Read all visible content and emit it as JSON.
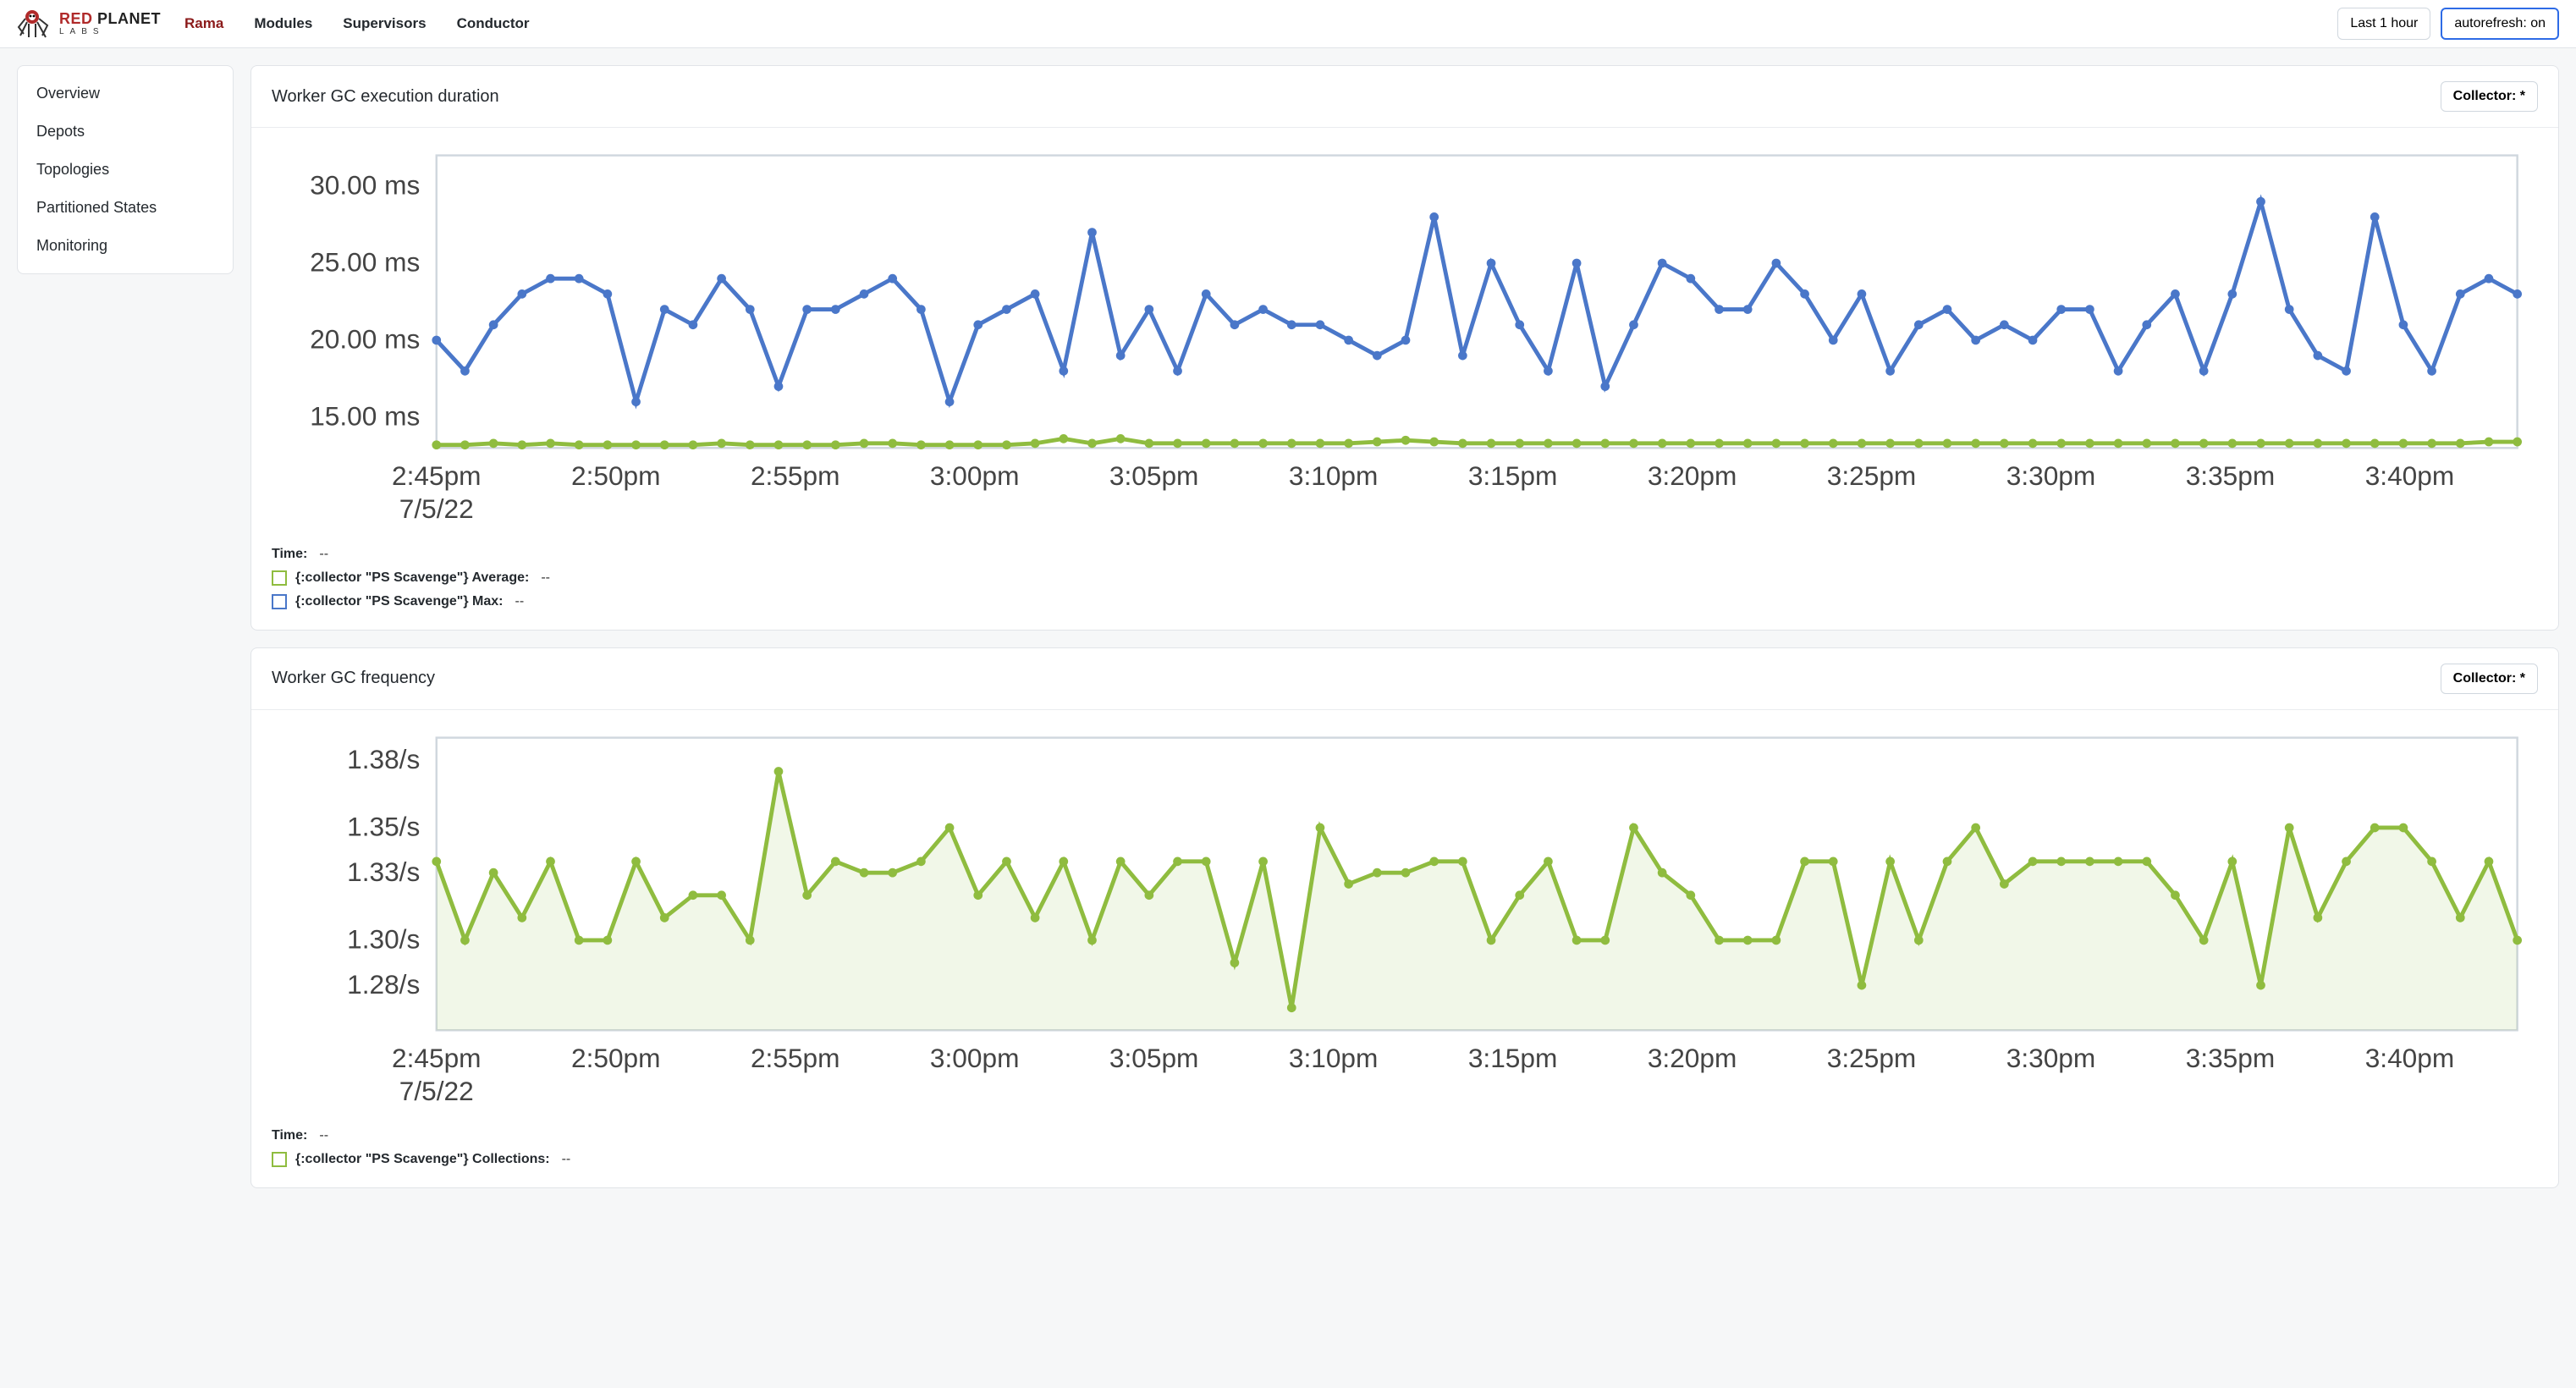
{
  "header": {
    "logo_line1_a": "RED",
    "logo_line1_b": "PLANET",
    "logo_line2": "LABS",
    "nav": [
      "Rama",
      "Modules",
      "Supervisors",
      "Conductor"
    ],
    "timerange_label": "Last 1 hour",
    "autorefresh_label": "autorefresh: on"
  },
  "sidebar": {
    "items": [
      "Overview",
      "Depots",
      "Topologies",
      "Partitioned States",
      "Monitoring"
    ]
  },
  "collector_label": "Collector: *",
  "panels": [
    {
      "title": "Worker GC execution duration",
      "legend": [
        {
          "kind": "time",
          "label": "Time:",
          "value": "--"
        },
        {
          "kind": "green",
          "label": "{:collector \"PS Scavenge\"} Average:",
          "value": "--"
        },
        {
          "kind": "blue",
          "label": "{:collector \"PS Scavenge\"} Max:",
          "value": "--"
        }
      ]
    },
    {
      "title": "Worker GC frequency",
      "legend": [
        {
          "kind": "time",
          "label": "Time:",
          "value": "--"
        },
        {
          "kind": "green",
          "label": "{:collector \"PS Scavenge\"} Collections:",
          "value": "--"
        }
      ]
    }
  ],
  "chart_data": [
    {
      "type": "line",
      "title": "Worker GC execution duration",
      "xlabel": "",
      "ylabel": "",
      "x_start_label": "2:45pm",
      "x_start_date": "7/5/22",
      "x_tick_labels": [
        "2:45pm",
        "2:50pm",
        "2:55pm",
        "3:00pm",
        "3:05pm",
        "3:10pm",
        "3:15pm",
        "3:20pm",
        "3:25pm",
        "3:30pm",
        "3:35pm",
        "3:40pm"
      ],
      "y_tick_labels": [
        "15.00 ms",
        "20.00 ms",
        "25.00 ms",
        "30.00 ms"
      ],
      "ylim": [
        13,
        32
      ],
      "series": [
        {
          "name": "{:collector \"PS Scavenge\"} Max",
          "color": "#4a77c9",
          "values": [
            20,
            18,
            21,
            23,
            24,
            24,
            23,
            16,
            22,
            21,
            24,
            22,
            17,
            22,
            22,
            23,
            24,
            22,
            16,
            21,
            22,
            23,
            18,
            27,
            19,
            22,
            18,
            23,
            21,
            22,
            21,
            21,
            20,
            19,
            20,
            28,
            19,
            25,
            21,
            18,
            25,
            17,
            21,
            25,
            24,
            22,
            22,
            25,
            23,
            20,
            23,
            18,
            21,
            22,
            20,
            21,
            20,
            22,
            22,
            18,
            21,
            23,
            18,
            23,
            29,
            22,
            19,
            18,
            28,
            21,
            18,
            23,
            24,
            23
          ]
        },
        {
          "name": "{:collector \"PS Scavenge\"} Average",
          "color": "#8fbc3f",
          "values": [
            13.2,
            13.2,
            13.3,
            13.2,
            13.3,
            13.2,
            13.2,
            13.2,
            13.2,
            13.2,
            13.3,
            13.2,
            13.2,
            13.2,
            13.2,
            13.3,
            13.3,
            13.2,
            13.2,
            13.2,
            13.2,
            13.3,
            13.6,
            13.3,
            13.6,
            13.3,
            13.3,
            13.3,
            13.3,
            13.3,
            13.3,
            13.3,
            13.3,
            13.4,
            13.5,
            13.4,
            13.3,
            13.3,
            13.3,
            13.3,
            13.3,
            13.3,
            13.3,
            13.3,
            13.3,
            13.3,
            13.3,
            13.3,
            13.3,
            13.3,
            13.3,
            13.3,
            13.3,
            13.3,
            13.3,
            13.3,
            13.3,
            13.3,
            13.3,
            13.3,
            13.3,
            13.3,
            13.3,
            13.3,
            13.3,
            13.3,
            13.3,
            13.3,
            13.3,
            13.3,
            13.3,
            13.3,
            13.4,
            13.4
          ]
        }
      ]
    },
    {
      "type": "area",
      "title": "Worker GC frequency",
      "xlabel": "",
      "ylabel": "",
      "x_start_label": "2:45pm",
      "x_start_date": "7/5/22",
      "x_tick_labels": [
        "2:45pm",
        "2:50pm",
        "2:55pm",
        "3:00pm",
        "3:05pm",
        "3:10pm",
        "3:15pm",
        "3:20pm",
        "3:25pm",
        "3:30pm",
        "3:35pm",
        "3:40pm"
      ],
      "y_tick_labels": [
        "1.28/s",
        "1.30/s",
        "1.33/s",
        "1.35/s",
        "1.38/s"
      ],
      "y_tick_values": [
        1.28,
        1.3,
        1.33,
        1.35,
        1.38
      ],
      "ylim": [
        1.26,
        1.39
      ],
      "series": [
        {
          "name": "{:collector \"PS Scavenge\"} Collections",
          "color": "#8fbc3f",
          "values": [
            1.335,
            1.3,
            1.33,
            1.31,
            1.335,
            1.3,
            1.3,
            1.335,
            1.31,
            1.32,
            1.32,
            1.3,
            1.375,
            1.32,
            1.335,
            1.33,
            1.33,
            1.335,
            1.35,
            1.32,
            1.335,
            1.31,
            1.335,
            1.3,
            1.335,
            1.32,
            1.335,
            1.335,
            1.29,
            1.335,
            1.27,
            1.35,
            1.325,
            1.33,
            1.33,
            1.335,
            1.335,
            1.3,
            1.32,
            1.335,
            1.3,
            1.3,
            1.35,
            1.33,
            1.32,
            1.3,
            1.3,
            1.3,
            1.335,
            1.335,
            1.28,
            1.335,
            1.3,
            1.335,
            1.35,
            1.325,
            1.335,
            1.335,
            1.335,
            1.335,
            1.335,
            1.32,
            1.3,
            1.335,
            1.28,
            1.35,
            1.31,
            1.335,
            1.35,
            1.35,
            1.335,
            1.31,
            1.335,
            1.3
          ]
        }
      ]
    }
  ]
}
